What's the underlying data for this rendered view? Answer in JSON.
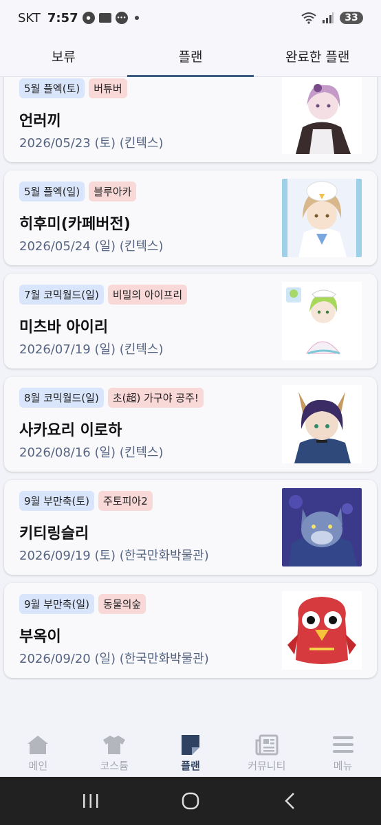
{
  "status": {
    "carrier": "SKT",
    "time": "7:57",
    "battery": "33"
  },
  "tabs": [
    {
      "label": "보류"
    },
    {
      "label": "플랜"
    },
    {
      "label": "완료한 플랜"
    }
  ],
  "plans": [
    {
      "event": "5월 플엑(토)",
      "series": "버튜버",
      "title": "언러끼",
      "date": "2026/05/23 (토) (킨텍스)",
      "thumb": "character-thumbnail"
    },
    {
      "event": "5월 플엑(일)",
      "series": "블루아카",
      "title": "히후미(카페버전)",
      "date": "2026/05/24 (일) (킨텍스)",
      "thumb": "character-thumbnail"
    },
    {
      "event": "7월 코믹월드(일)",
      "series": "비밀의 아이프리",
      "title": "미츠바 아이리",
      "date": "2026/07/19 (일) (킨텍스)",
      "thumb": "character-thumbnail"
    },
    {
      "event": "8월 코믹월드(일)",
      "series": "초(超) 가구야 공주!",
      "title": "사카요리 이로하",
      "date": "2026/08/16 (일) (킨텍스)",
      "thumb": "character-thumbnail"
    },
    {
      "event": "9월 부만축(토)",
      "series": "주토피아2",
      "title": "키티링슬리",
      "date": "2026/09/19 (토) (한국만화박물관)",
      "thumb": "character-thumbnail"
    },
    {
      "event": "9월 부만축(일)",
      "series": "동물의숲",
      "title": "부옥이",
      "date": "2026/09/20 (일) (한국만화박물관)",
      "thumb": "character-thumbnail"
    }
  ],
  "bottom_nav": [
    {
      "label": "메인",
      "icon": "home-icon"
    },
    {
      "label": "코스튬",
      "icon": "shirt-icon"
    },
    {
      "label": "플랜",
      "icon": "note-icon"
    },
    {
      "label": "커뮤니티",
      "icon": "newspaper-icon"
    },
    {
      "label": "메뉴",
      "icon": "menu-icon"
    }
  ],
  "colors": {
    "accent": "#3d5a80",
    "event_chip": "#d9e5fb",
    "series_chip": "#f9d8d8",
    "date_text": "#566582"
  }
}
